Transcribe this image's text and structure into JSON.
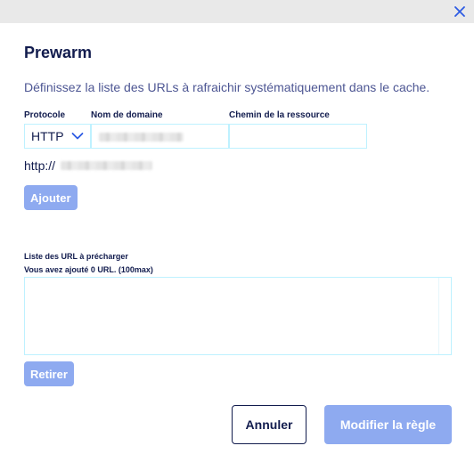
{
  "dialog": {
    "title": "Prewarm",
    "subtitle": "Définissez la liste des URLs à rafraichir systématiquement dans le cache.",
    "close_icon": "close-icon"
  },
  "form": {
    "protocol_label": "Protocole",
    "protocol_value": "HTTP",
    "domain_label": "Nom de domaine",
    "domain_value": "",
    "path_label": "Chemin de la ressource",
    "path_value": "",
    "url_preview_prefix": "http://",
    "add_button": "Ajouter"
  },
  "list": {
    "label": "Liste des URL à précharger",
    "count_text": "Vous avez ajouté 0 URL. (100max)",
    "items": [],
    "remove_button": "Retirer"
  },
  "footer": {
    "cancel_button": "Annuler",
    "submit_button": "Modifier la règle"
  },
  "colors": {
    "primary_disabled": "#8eaaf0",
    "text_dark": "#121c4e",
    "text_medium": "#4d5693",
    "input_border": "#bef1ff",
    "topbar": "#e9e9e9",
    "accent": "#2d5be3"
  }
}
